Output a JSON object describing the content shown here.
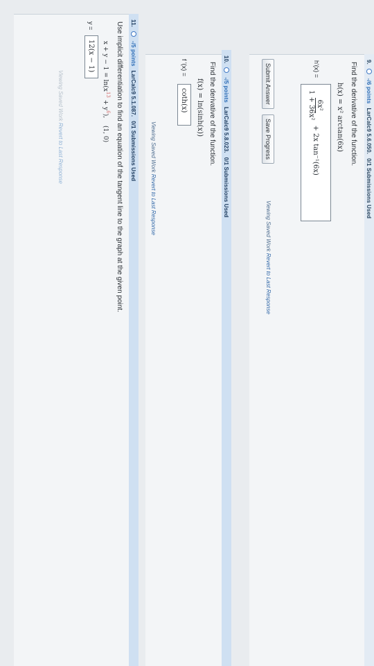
{
  "q9": {
    "number": "9.",
    "points": "-/6 points",
    "source": "LarCalc9 5.6.050.",
    "submissions": "0/1 Submissions Used",
    "prompt": "Find the derivative of the function.",
    "function": "h(x) = x² arctan(6x)",
    "answer_label": "h'(x) =",
    "answer": {
      "numerator": "6x²",
      "denominator": "1 + 36x²",
      "rest": "+ 2x tan⁻¹(6x)"
    },
    "submit_label": "Submit Answer",
    "save_label": "Save Progress",
    "viewing_text": "Viewing Saved Work",
    "revert_text": "Revert to Last Response"
  },
  "q10": {
    "number": "10.",
    "points": "-/5 points",
    "source": "LarCalc9 5.8.023.",
    "submissions": "0/1 Submissions Used",
    "prompt": "Find the derivative of the function.",
    "function": "f(x) = ln(sinh(x))",
    "answer_label": "f '(x) =",
    "answer": "coth(x)",
    "viewing_text": "Viewing Saved Work",
    "revert_text": "Revert to Last Response"
  },
  "q11": {
    "number": "11.",
    "points": "-/5 points",
    "source": "LarCalc9 5.1.087.",
    "submissions": "0/1 Submissions Used",
    "prompt": "Use implicit differentiation to find an equation of the tangent line to the graph at the given point.",
    "equation_prefix": "x + y − 1 = ln(x",
    "exp_a": "13",
    "equation_mid": " + y",
    "exp_b": "6",
    "equation_suffix": "),",
    "point": "(1, 0)",
    "answer_label": "y =",
    "answer": "12(x − 1)",
    "viewing_text": "Viewing Saved Work",
    "revert_text": "Revert to Last Response"
  }
}
